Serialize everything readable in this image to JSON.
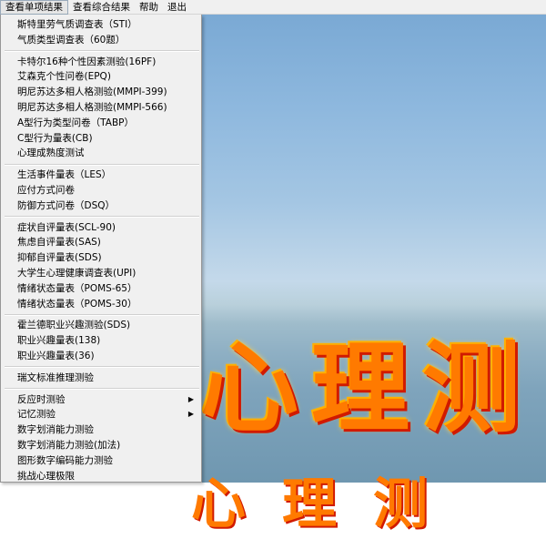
{
  "menubar": [
    {
      "label": "查看单项结果",
      "active": true
    },
    {
      "label": "查看综合结果",
      "active": false
    },
    {
      "label": "帮助",
      "active": false
    },
    {
      "label": "退出",
      "active": false
    }
  ],
  "background_text": {
    "line1": "心理测",
    "line2": "心理测"
  },
  "dropdown": {
    "groups": [
      [
        "斯特里劳气质调查表（STI）",
        "气质类型调查表（60题）"
      ],
      [
        "卡特尔16种个性因素测验(16PF)",
        "艾森克个性问卷(EPQ)",
        "明尼苏达多相人格测验(MMPI-399)",
        "明尼苏达多相人格测验(MMPI-566)",
        "A型行为类型问卷（TABP）",
        "C型行为量表(CB)",
        "心理成熟度测试"
      ],
      [
        "生活事件量表（LES）",
        "应付方式问卷",
        "防御方式问卷（DSQ）"
      ],
      [
        "症状自评量表(SCL-90)",
        "焦虑自评量表(SAS)",
        "抑郁自评量表(SDS)",
        "大学生心理健康调查表(UPI)",
        "情绪状态量表（POMS-65）",
        "情绪状态量表（POMS-30）"
      ],
      [
        "霍兰德职业兴趣测验(SDS)",
        "职业兴趣量表(138)",
        "职业兴趣量表(36)"
      ],
      [
        "瑞文标准推理测验"
      ],
      [
        "反应时测验",
        "记忆测验",
        "数字划消能力测验",
        "数字划消能力测验(加法)",
        "图形数字编码能力测验",
        "挑战心理极限"
      ]
    ],
    "submenu_items": [
      "反应时测验",
      "记忆测验"
    ],
    "submenu_arrow": "▶"
  }
}
